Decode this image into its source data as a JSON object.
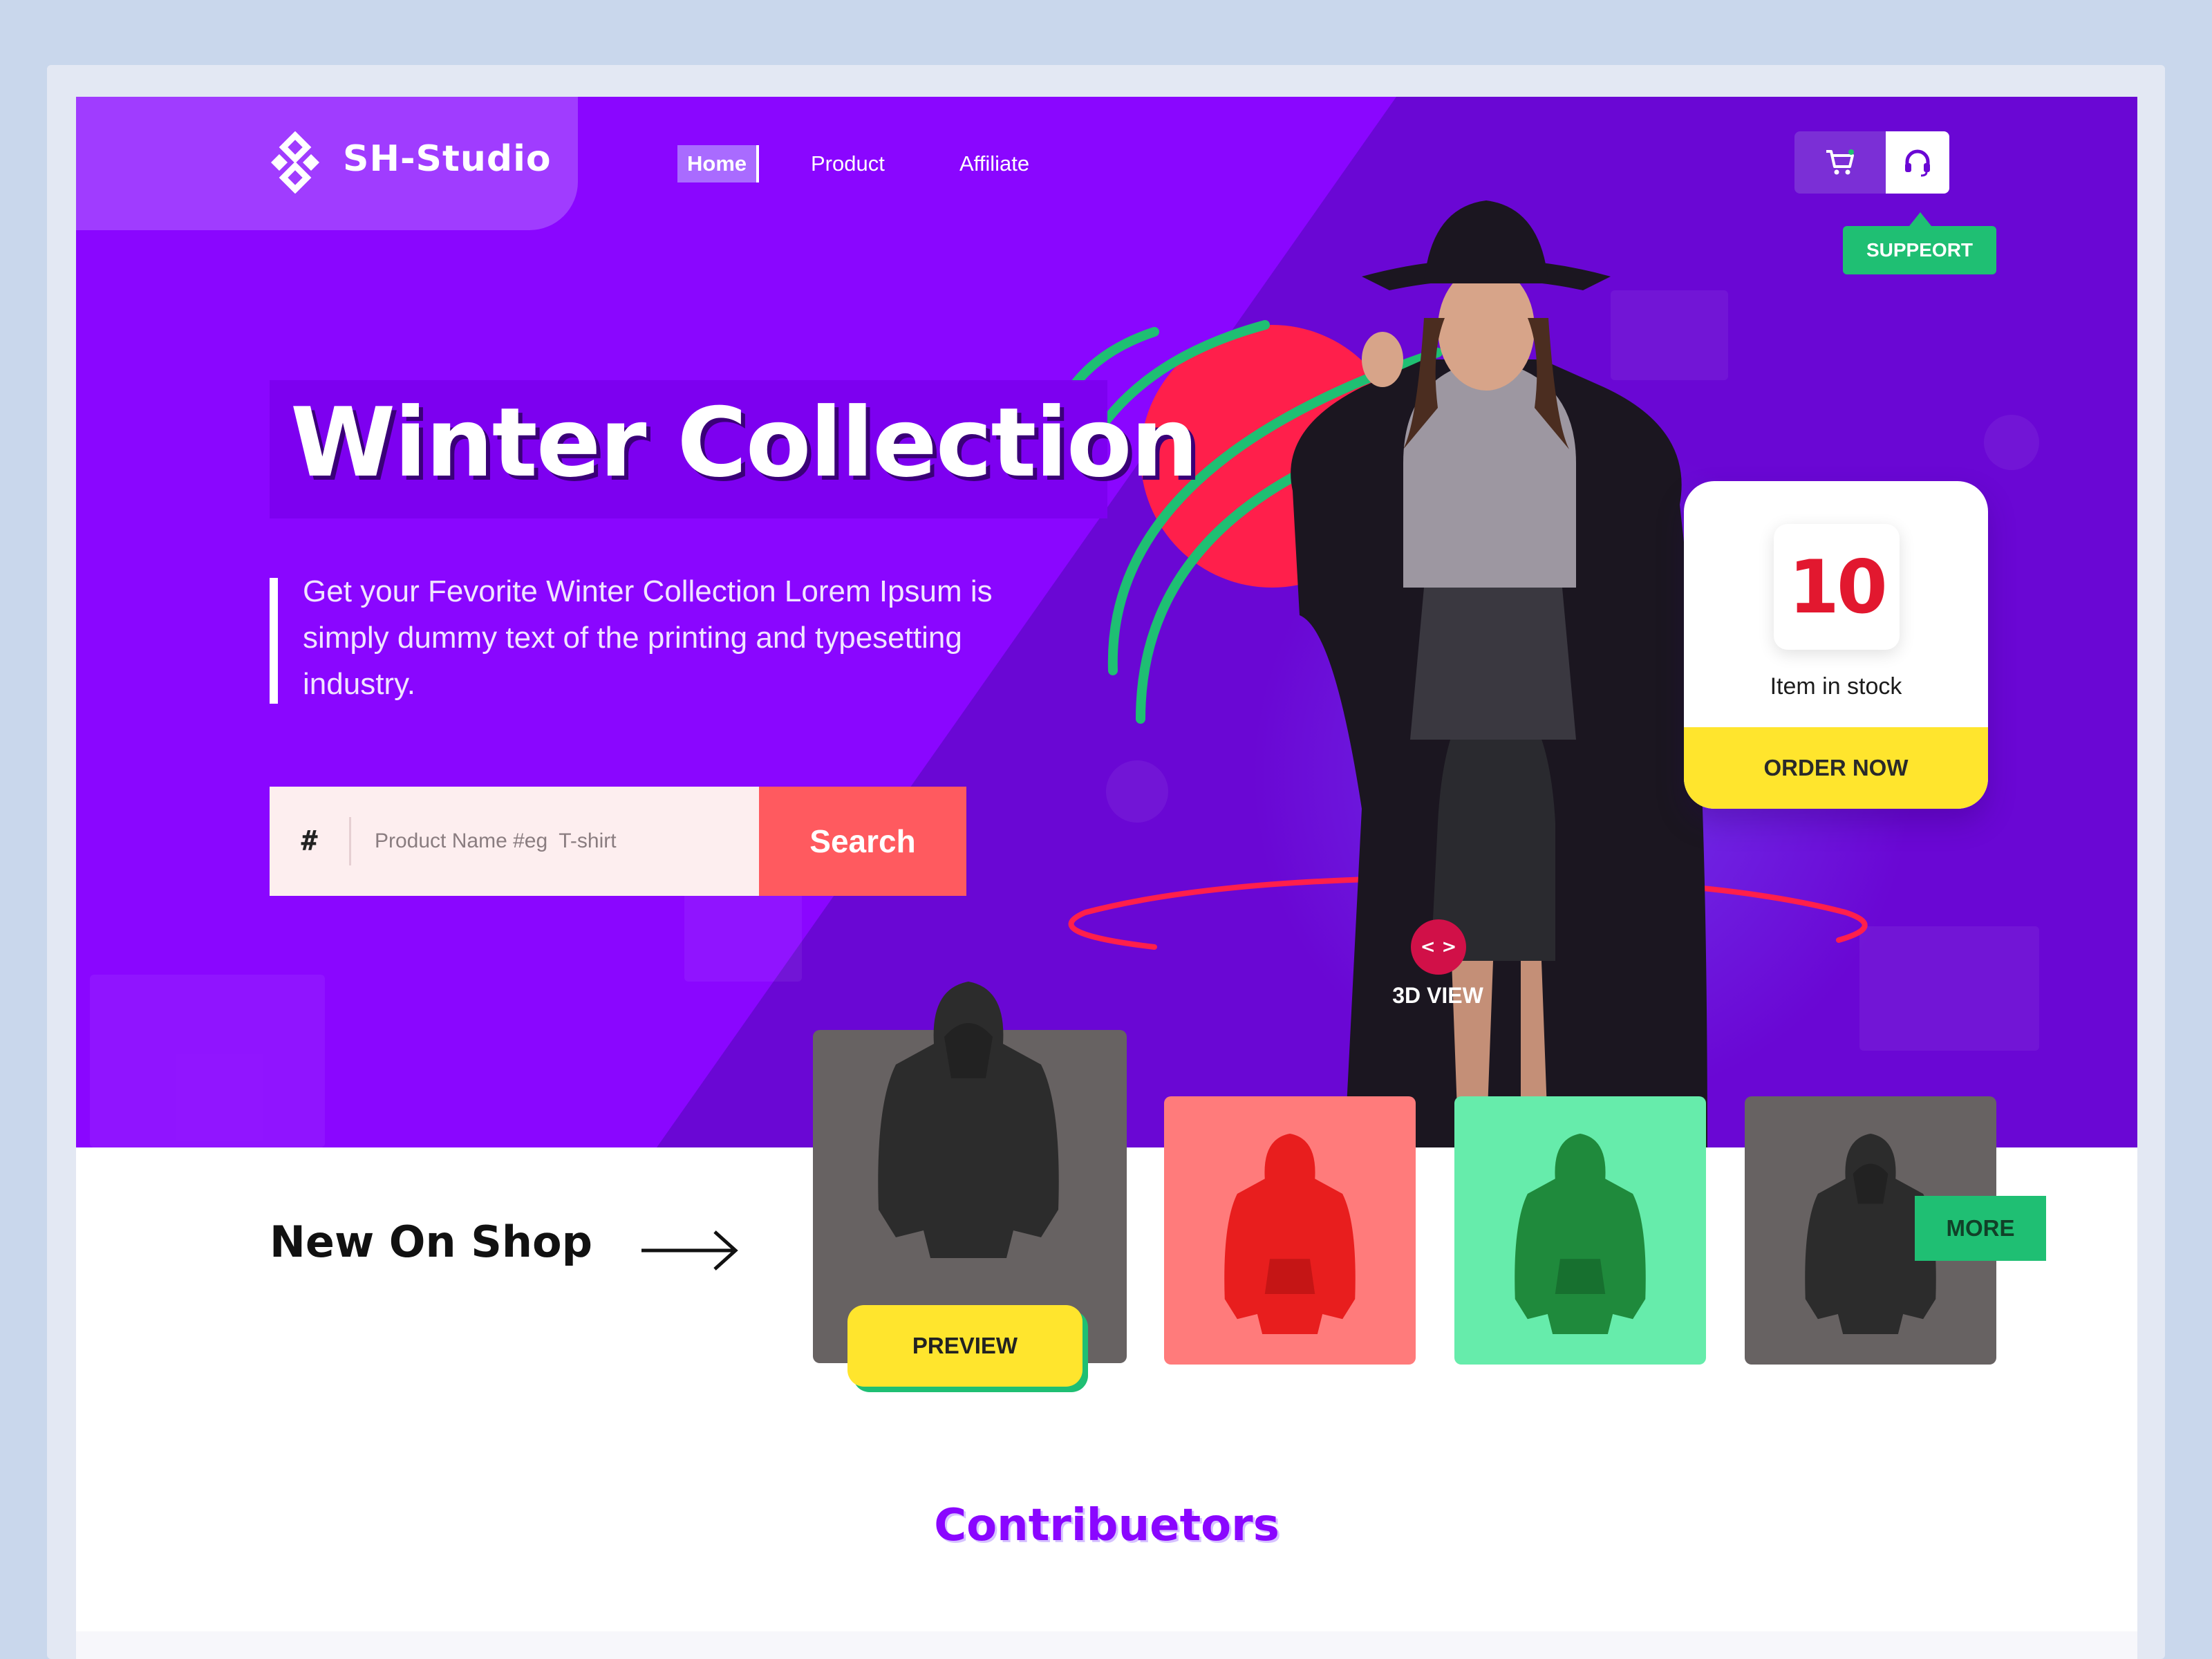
{
  "brand": {
    "name": "SH-Studio"
  },
  "nav": {
    "home": "Home",
    "product": "Product",
    "affiliate": "Affiliate"
  },
  "header": {
    "support_tooltip": "SUPPEORT"
  },
  "hero": {
    "title": "Winter Collection",
    "description": "Get your Fevorite Winter Collection Lorem Ipsum is simply dummy text of the printing and typesetting industry.",
    "view_label": "3D VIEW",
    "view_icon": "< >"
  },
  "search": {
    "prefix": "#",
    "placeholder": "Product Name #eg  T-shirt",
    "button": "Search"
  },
  "stock_card": {
    "count": "10",
    "label": "Item in stock",
    "button": "ORDER NOW"
  },
  "new_on_shop": {
    "title": "New On Shop",
    "preview_button": "PREVIEW",
    "more_button": "MORE",
    "products": [
      {
        "bg": "#676262",
        "hoodie_color": "#2c2c2c"
      },
      {
        "bg": "#ff7b7b",
        "hoodie_color": "#e81e1e"
      },
      {
        "bg": "#66ecab",
        "hoodie_color": "#1f8a3c"
      },
      {
        "bg": "#676262",
        "hoodie_color": "#2c2c2c"
      }
    ]
  },
  "contributors": {
    "title": "Contribuetors"
  },
  "colors": {
    "hero_purple": "#8a06ff",
    "accent_red": "#ff5a5f",
    "accent_yellow": "#ffe52d",
    "accent_green": "#1fbf73"
  },
  "icons": [
    "logo-icon",
    "cart-icon",
    "headset-icon",
    "arrow-right-icon",
    "code-icon"
  ]
}
